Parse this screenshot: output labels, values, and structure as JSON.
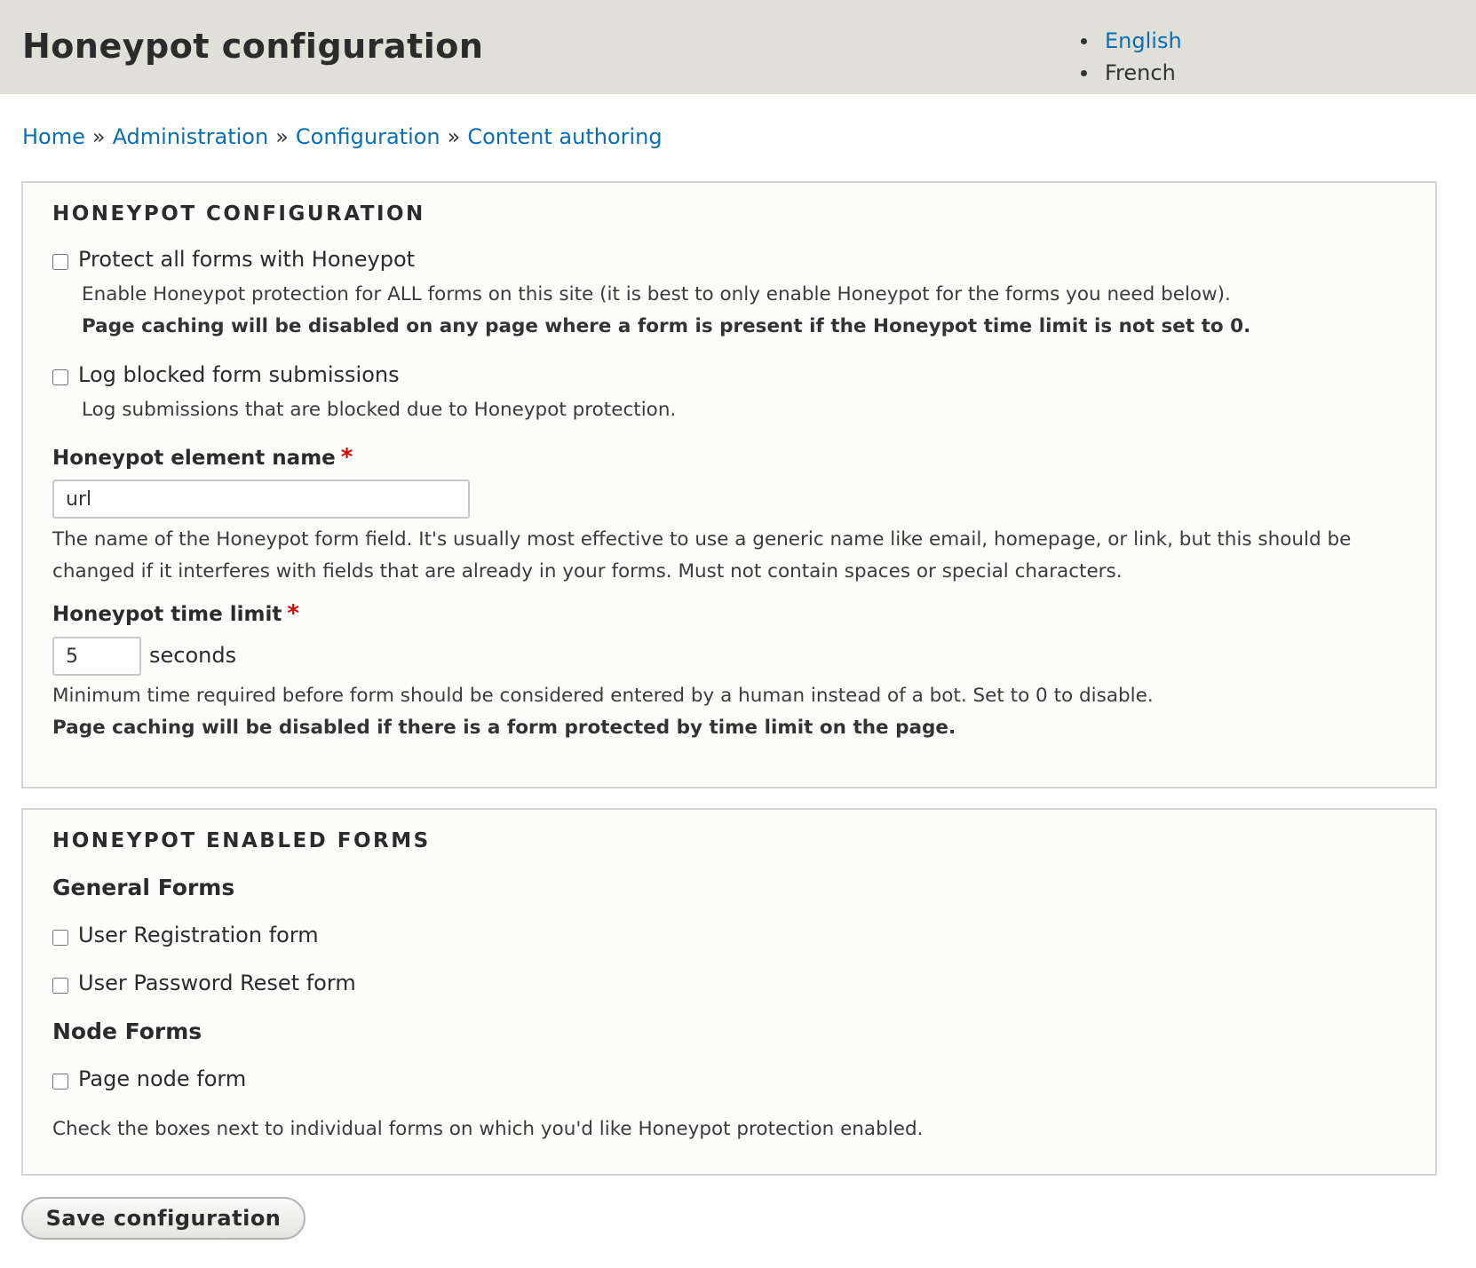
{
  "header": {
    "title": "Honeypot configuration",
    "languages": [
      "English",
      "French"
    ]
  },
  "breadcrumb": {
    "items": [
      "Home",
      "Administration",
      "Configuration",
      "Content authoring"
    ],
    "separator": "»"
  },
  "config_section": {
    "legend": "HONEYPOT CONFIGURATION",
    "protect_all": {
      "label": "Protect all forms with Honeypot",
      "checked": false,
      "description": "Enable Honeypot protection for ALL forms on this site (it is best to only enable Honeypot for the forms you need below).",
      "warning": "Page caching will be disabled on any page where a form is present if the Honeypot time limit is not set to 0."
    },
    "log_blocked": {
      "label": "Log blocked form submissions",
      "checked": false,
      "description": "Log submissions that are blocked due to Honeypot protection."
    },
    "element_name": {
      "label": "Honeypot element name",
      "required_marker": "*",
      "value": "url",
      "description_line1": "The name of the Honeypot form field. It's usually most effective to use a generic name like email, homepage, or link, but this should be",
      "description_line2": "changed if it interferes with fields that are already in your forms. Must not contain spaces or special characters."
    },
    "time_limit": {
      "label": "Honeypot time limit",
      "required_marker": "*",
      "value": "5",
      "suffix": "seconds",
      "description": "Minimum time required before form should be considered entered by a human instead of a bot. Set to 0 to disable.",
      "warning": "Page caching will be disabled if there is a form protected by time limit on the page."
    }
  },
  "forms_section": {
    "legend": "HONEYPOT ENABLED FORMS",
    "general_title": "General Forms",
    "general_forms": [
      {
        "label": "User Registration form",
        "checked": false
      },
      {
        "label": "User Password Reset form",
        "checked": false
      }
    ],
    "node_title": "Node Forms",
    "node_forms": [
      {
        "label": "Page node form",
        "checked": false
      }
    ],
    "help": "Check the boxes next to individual forms on which you'd like Honeypot protection enabled."
  },
  "actions": {
    "save_label": "Save configuration"
  },
  "colors": {
    "link": "#0a6eb4",
    "header_bg": "#e0e0d8",
    "required": "#e00000"
  }
}
